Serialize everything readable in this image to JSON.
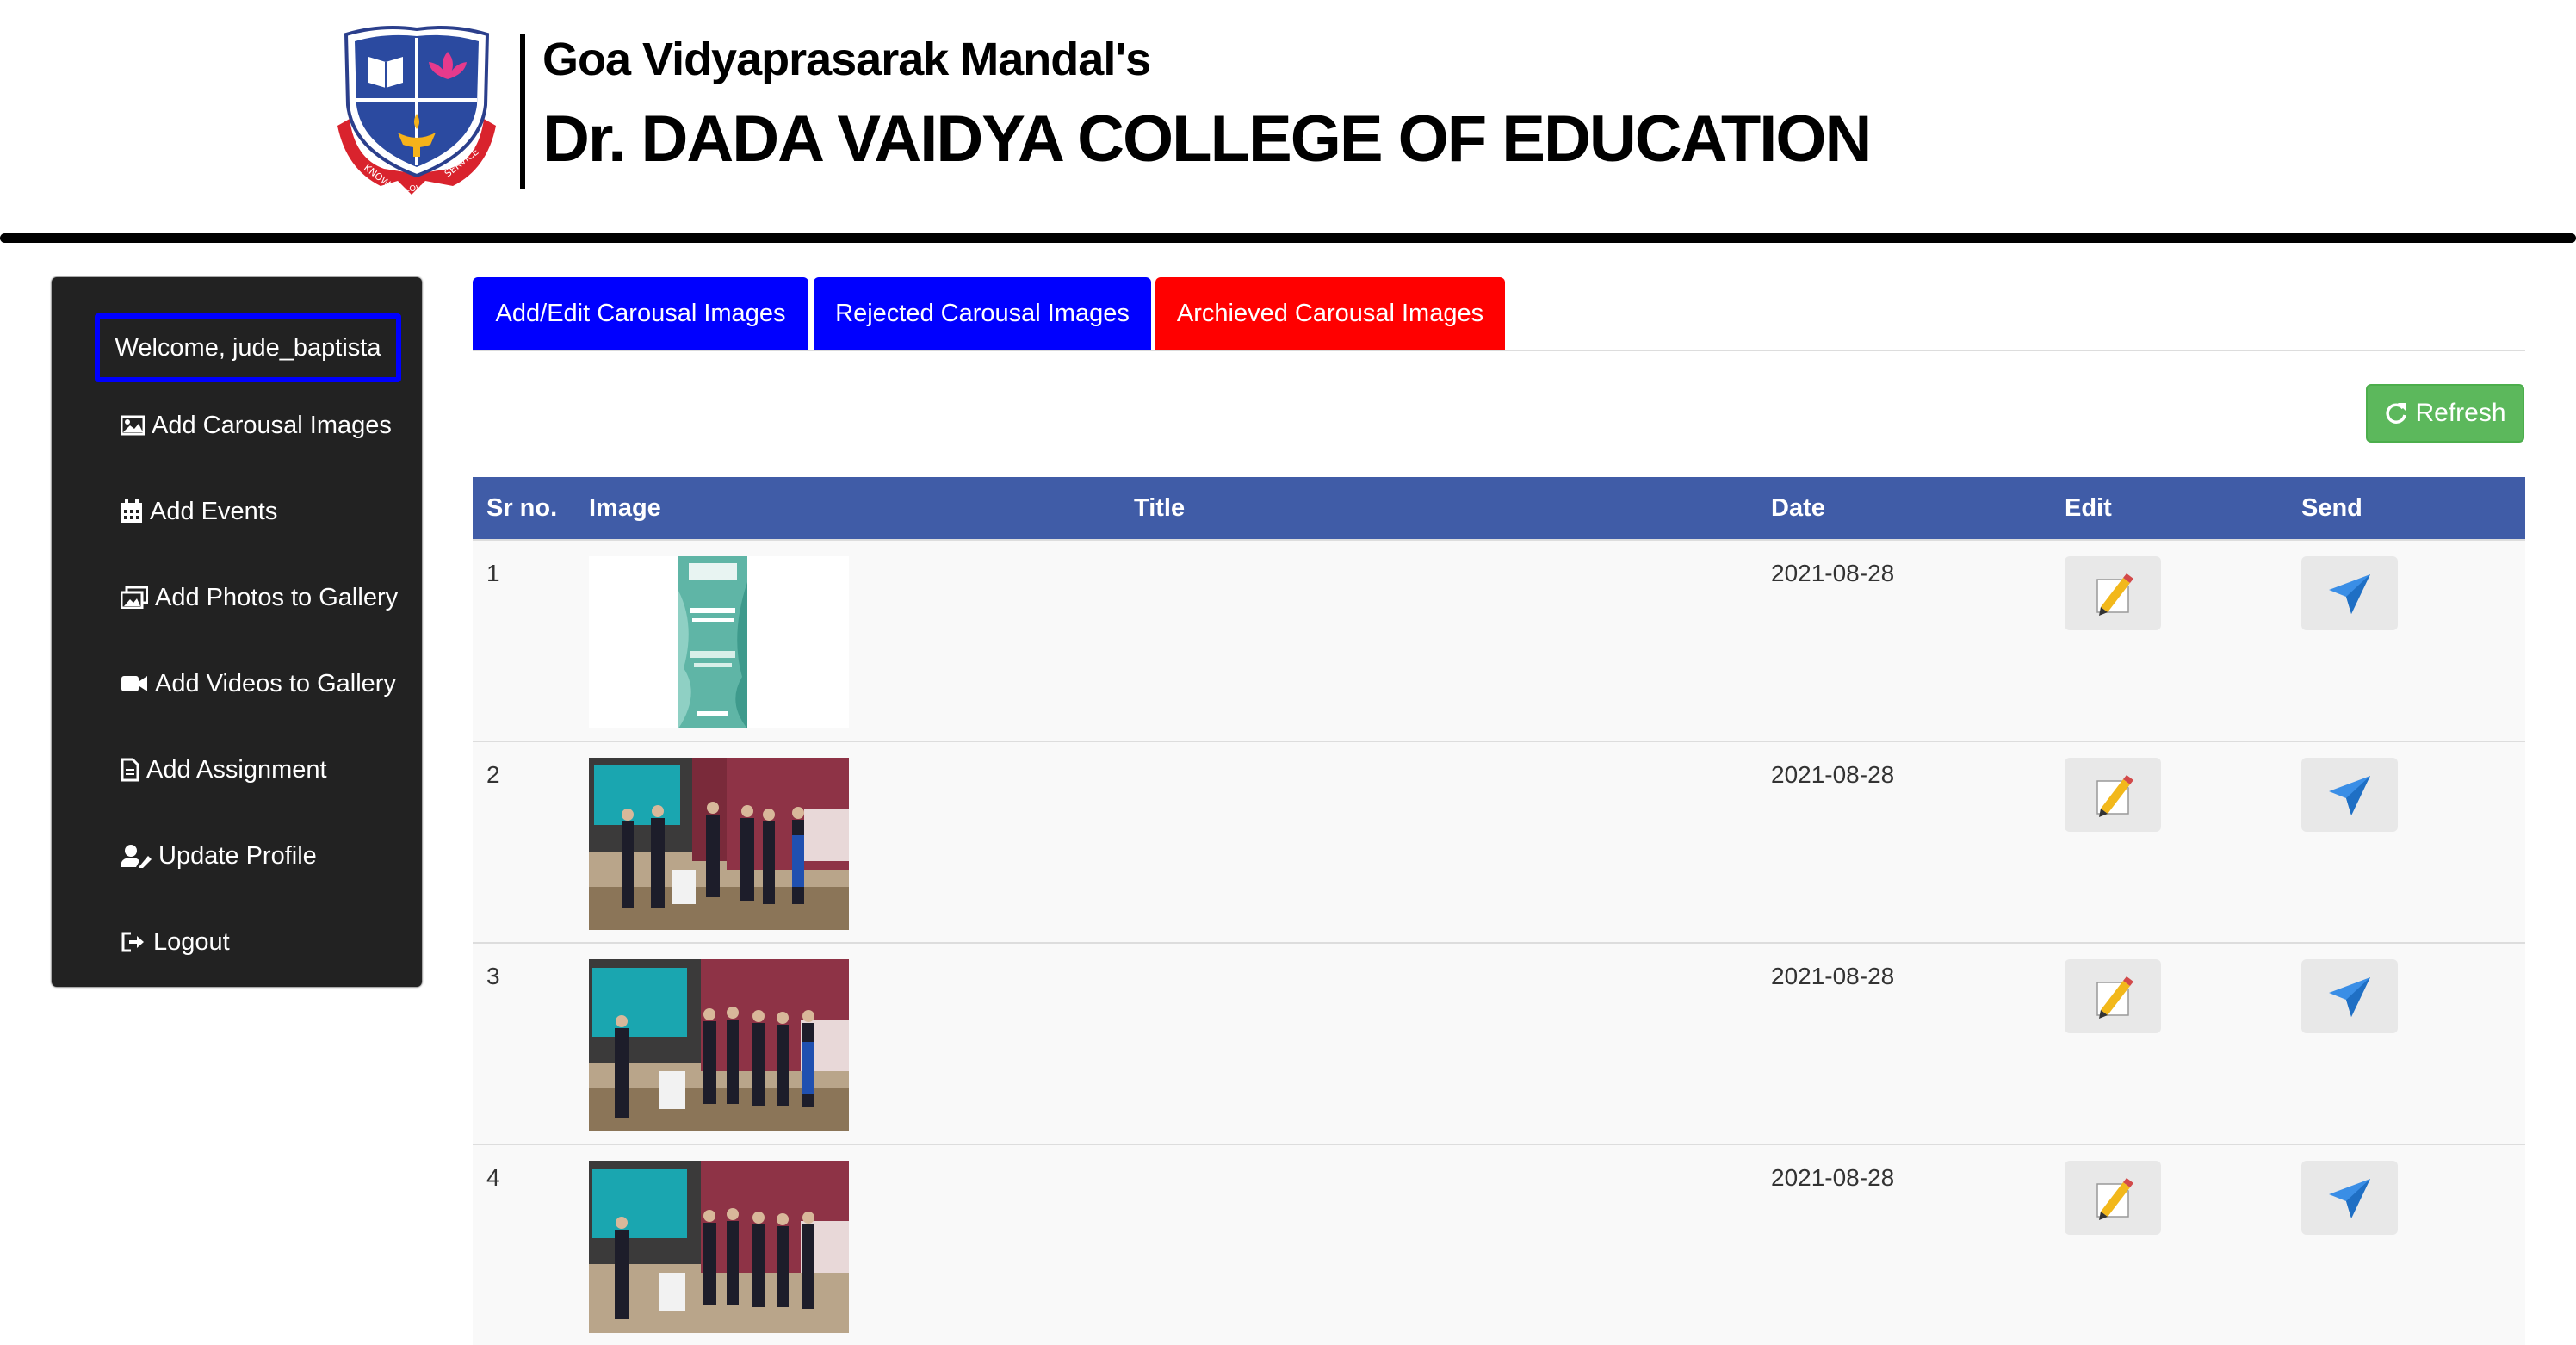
{
  "header": {
    "org_name": "Goa Vidyaprasarak Mandal's",
    "college_name": "Dr. DADA VAIDYA COLLEGE OF EDUCATION",
    "logo_motto": [
      "KNOWLEDGE",
      "LOVE",
      "SERVICE"
    ]
  },
  "sidebar": {
    "welcome": "Welcome, jude_baptista",
    "items": [
      {
        "label": "Add Carousal Images",
        "icon": "image-icon"
      },
      {
        "label": "Add Events",
        "icon": "calendar-icon"
      },
      {
        "label": "Add Photos to Gallery",
        "icon": "images-icon"
      },
      {
        "label": "Add Videos to Gallery",
        "icon": "video-icon"
      },
      {
        "label": "Add Assignment",
        "icon": "file-icon"
      },
      {
        "label": "Update Profile",
        "icon": "user-edit-icon"
      },
      {
        "label": "Logout",
        "icon": "sign-out-icon"
      }
    ]
  },
  "tabs": [
    {
      "label": "Add/Edit Carousal Images",
      "color": "#0000ff"
    },
    {
      "label": "Rejected Carousal Images",
      "color": "#0000ff"
    },
    {
      "label": "Archieved Carousal Images",
      "color": "#ff0000"
    }
  ],
  "refresh_label": "Refresh",
  "table": {
    "headers": [
      "Sr no.",
      "Image",
      "Title",
      "Date",
      "Edit",
      "Send"
    ],
    "rows": [
      {
        "sr": "1",
        "title": "",
        "date": "2021-08-28",
        "image": "poster"
      },
      {
        "sr": "2",
        "title": "",
        "date": "2021-08-28",
        "image": "photo"
      },
      {
        "sr": "3",
        "title": "",
        "date": "2021-08-28",
        "image": "photo"
      },
      {
        "sr": "4",
        "title": "",
        "date": "2021-08-28",
        "image": "photo"
      }
    ]
  },
  "colors": {
    "header_bar": "#405ca7",
    "refresh": "#5cb85c",
    "sidebar_bg": "#222222",
    "tab_blue": "#0000ff",
    "tab_red": "#ff0000"
  }
}
